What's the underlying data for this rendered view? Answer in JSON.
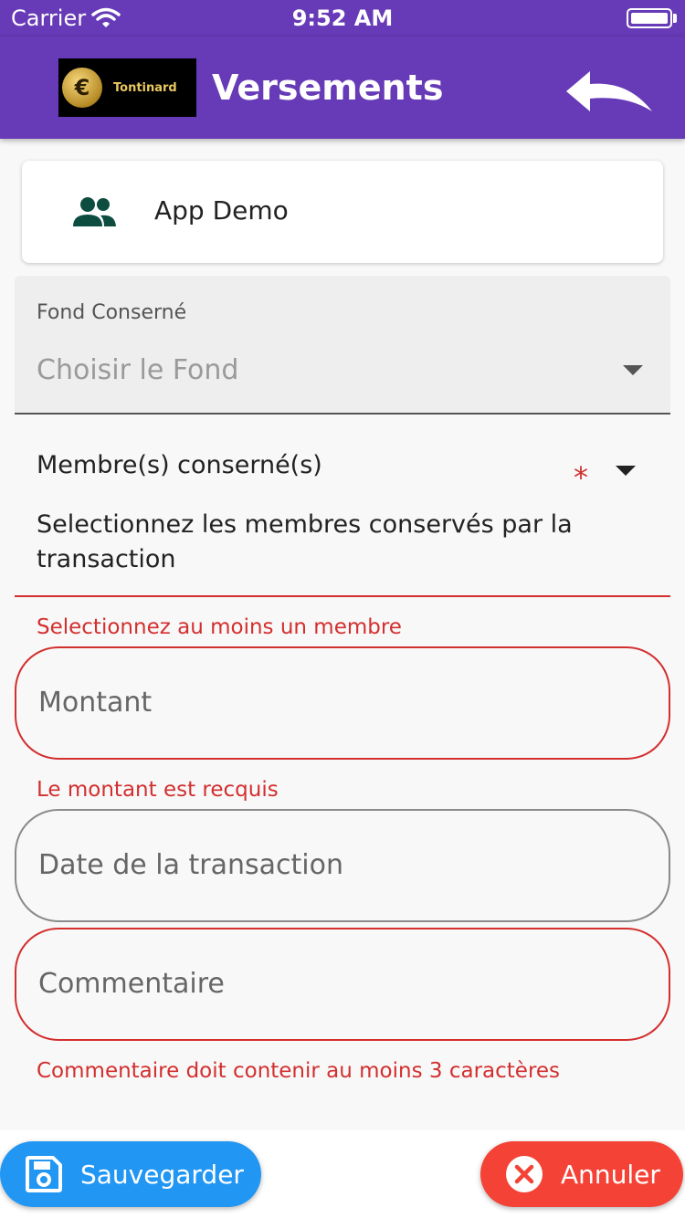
{
  "status_bar": {
    "carrier": "Carrier",
    "time": "9:52 AM"
  },
  "header": {
    "logo_text": "Tontinard",
    "logo_badge": "€",
    "title": "Versements",
    "back_icon": "undo-arrow-icon",
    "color": "#673ab7"
  },
  "group": {
    "icon": "group-icon",
    "name": "App Demo"
  },
  "fond": {
    "label": "Fond Conserné",
    "placeholder": "Choisir le Fond"
  },
  "members": {
    "label": "Membre(s) conserné(s)",
    "required_mark": "*",
    "hint": "Selectionnez les membres conservés par la transaction",
    "error": "Selectionnez au moins un membre"
  },
  "amount": {
    "placeholder": "Montant",
    "error": "Le montant est recquis"
  },
  "date": {
    "placeholder": "Date de la transaction"
  },
  "comment": {
    "placeholder": "Commentaire",
    "error": "Commentaire doit contenir au moins 3 caractères"
  },
  "actions": {
    "save_label": "Sauvegarder",
    "save_icon": "floppy-disk-icon",
    "save_color": "#2196f3",
    "cancel_label": "Annuler",
    "cancel_icon": "close-circle-icon",
    "cancel_color": "#f44336"
  },
  "colors": {
    "error": "#d32f2f",
    "accent": "#673ab7"
  }
}
